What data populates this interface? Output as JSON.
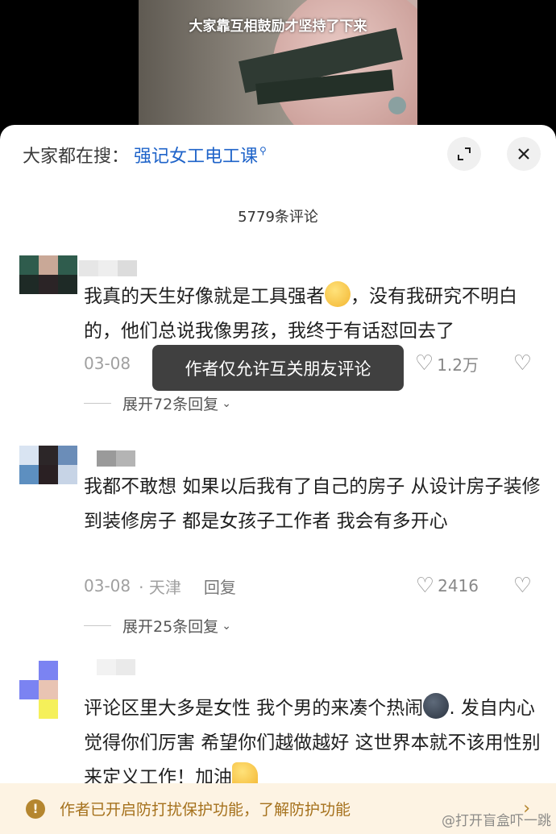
{
  "video": {
    "subtitle": "大家靠互相鼓励才坚持了下来"
  },
  "header": {
    "search_prefix": "大家都在搜：",
    "search_term": "强记女工电工课",
    "expand_icon": "expand-icon",
    "close_icon": "close-icon"
  },
  "comment_count": "5779条评论",
  "comments": [
    {
      "text_before_emoji": "我真的天生好像就是工具强者",
      "emoji": "teary-face",
      "text_after_emoji": "，没有我研究不明白的，他们总说我像男孩，我终于有话怼回去了",
      "date": "03-08",
      "location": "",
      "reply": "",
      "likes": "1.2万",
      "expand": "展开72条回复"
    },
    {
      "text": "我都不敢想 如果以后我有了自己的房子 从设计房子装修 到装修房子 都是女孩子工作者 我会有多开心",
      "date": "03-08",
      "location": "· 天津",
      "reply": "回复",
      "likes": "2416",
      "expand": "展开25条回复"
    },
    {
      "text_before_emoji": "评论区里大多是女性 我个男的来凑个热闹",
      "emoji": "dark-moon-face",
      "text_after_emoji": ". 发自内心觉得你们厉害 希望你们越做越好 这世界本就不该用性别来定义工作！加油",
      "emoji_end": "thumbs-up"
    }
  ],
  "toast": "作者仅允许互关朋友评论",
  "notice": {
    "text": "作者已开启防打扰保护功能，了解防护功能"
  },
  "watermark": "@打开盲盒吓一跳"
}
